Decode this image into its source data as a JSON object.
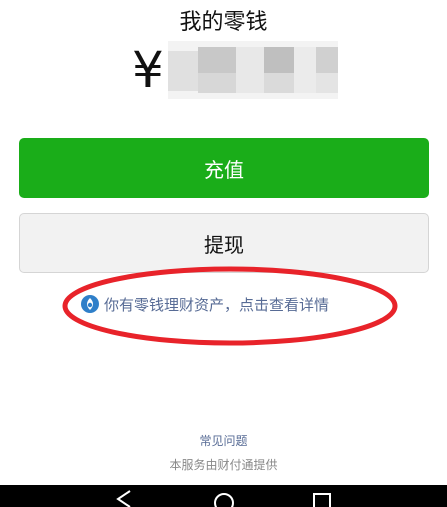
{
  "header": {
    "title": "我的零钱"
  },
  "balance": {
    "currency_symbol": "¥",
    "amount_state": "blurred"
  },
  "actions": {
    "recharge_label": "充值",
    "withdraw_label": "提现"
  },
  "wealth_notice": {
    "icon": "licaitong-icon",
    "text": "你有零钱理财资产，点击查看详情",
    "annotation": "red-circle"
  },
  "footer": {
    "faq_label": "常见问题",
    "provider_text": "本服务由财付通提供"
  },
  "nav": {
    "items": [
      "back-icon",
      "home-icon",
      "recents-icon"
    ]
  },
  "colors": {
    "primary_green": "#1aad19",
    "link_blue": "#576b95",
    "annotation_red": "#e8232a",
    "nav_black": "#000000"
  }
}
